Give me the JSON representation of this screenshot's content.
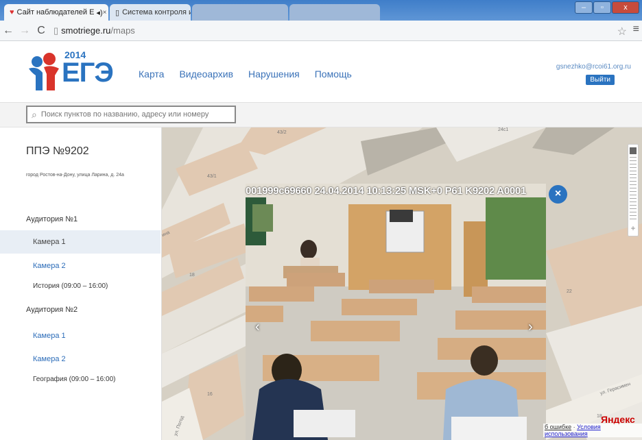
{
  "browser": {
    "tabs": [
      {
        "label": "Сайт наблюдателей Е",
        "close": "×"
      },
      {
        "label": "Система контроля и упр",
        "close": "×"
      }
    ],
    "url_domain": "smotriege.ru",
    "url_path": "/maps"
  },
  "header": {
    "logo_year": "2014",
    "logo_text": "ЕГЭ",
    "nav": [
      "Карта",
      "Видеоархив",
      "Нарушения",
      "Помощь"
    ],
    "user_email": "gsnezhko@rcoi61.org.ru",
    "logout_label": "Выйти"
  },
  "search": {
    "placeholder": "Поиск пунктов по названию, адресу или номеру"
  },
  "sidebar": {
    "title": "ППЭ №9202",
    "address": "город Ростов-на-Дону, улица Ларина, д. 24а",
    "auditoriums": [
      {
        "name": "Аудитория №1",
        "cameras": [
          "Камера 1",
          "Камера 2"
        ],
        "subject": "История (09:00 – 16:00)"
      },
      {
        "name": "Аудитория №2",
        "cameras": [
          "Камера 1",
          "Камера 2"
        ],
        "subject": "География (09:00 – 16:00)"
      }
    ]
  },
  "video": {
    "osd": "001999c69660 24.04.2014 10:13:25 MSK+0 P61 K9202 A0001",
    "close": "×",
    "prev": "‹",
    "next": "›"
  },
  "map": {
    "labels": [
      "43/2",
      "43/1",
      "18",
      "16",
      "22",
      "24с1",
      "ул. Герасимен",
      "18",
      "ина",
      "ул. Погод"
    ],
    "brand": "Яндекс",
    "footer_report": "б ошибке",
    "footer_sep": " · ",
    "footer_terms": "Условия использования"
  },
  "colors": {
    "accent": "#2a73c0",
    "link": "#3a72b8"
  }
}
